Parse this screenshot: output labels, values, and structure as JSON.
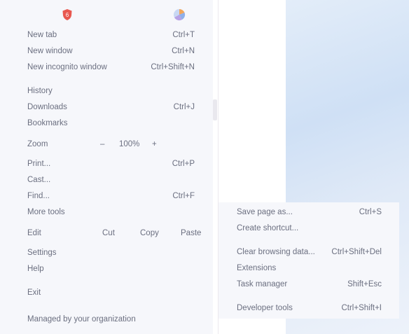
{
  "menu": {
    "new_tab": {
      "label": "New tab",
      "shortcut": "Ctrl+T"
    },
    "new_window": {
      "label": "New window",
      "shortcut": "Ctrl+N"
    },
    "new_incognito": {
      "label": "New incognito window",
      "shortcut": "Ctrl+Shift+N"
    },
    "history": {
      "label": "History"
    },
    "downloads": {
      "label": "Downloads",
      "shortcut": "Ctrl+J"
    },
    "bookmarks": {
      "label": "Bookmarks"
    },
    "zoom": {
      "label": "Zoom",
      "minus": "–",
      "value": "100%",
      "plus": "+"
    },
    "print": {
      "label": "Print...",
      "shortcut": "Ctrl+P"
    },
    "cast": {
      "label": "Cast..."
    },
    "find": {
      "label": "Find...",
      "shortcut": "Ctrl+F"
    },
    "more_tools": {
      "label": "More tools"
    },
    "edit": {
      "label": "Edit",
      "cut": "Cut",
      "copy": "Copy",
      "paste": "Paste"
    },
    "settings": {
      "label": "Settings"
    },
    "help": {
      "label": "Help"
    },
    "exit": {
      "label": "Exit"
    },
    "managed": {
      "label": "Managed by your organization"
    }
  },
  "submenu": {
    "save_page": {
      "label": "Save page as...",
      "shortcut": "Ctrl+S"
    },
    "create_shortcut": {
      "label": "Create shortcut..."
    },
    "clear_browsing": {
      "label": "Clear browsing data...",
      "shortcut": "Ctrl+Shift+Del"
    },
    "extensions": {
      "label": "Extensions"
    },
    "task_manager": {
      "label": "Task manager",
      "shortcut": "Shift+Esc"
    },
    "developer_tools": {
      "label": "Developer tools",
      "shortcut": "Ctrl+Shift+I"
    }
  },
  "icons": {
    "shield": "shield-icon",
    "profile": "pie-icon"
  },
  "colors": {
    "menu_bg": "#f6f7fb",
    "text": "#6b6f80",
    "shield_red": "#e8574f",
    "sky": "#cfe0f5"
  }
}
